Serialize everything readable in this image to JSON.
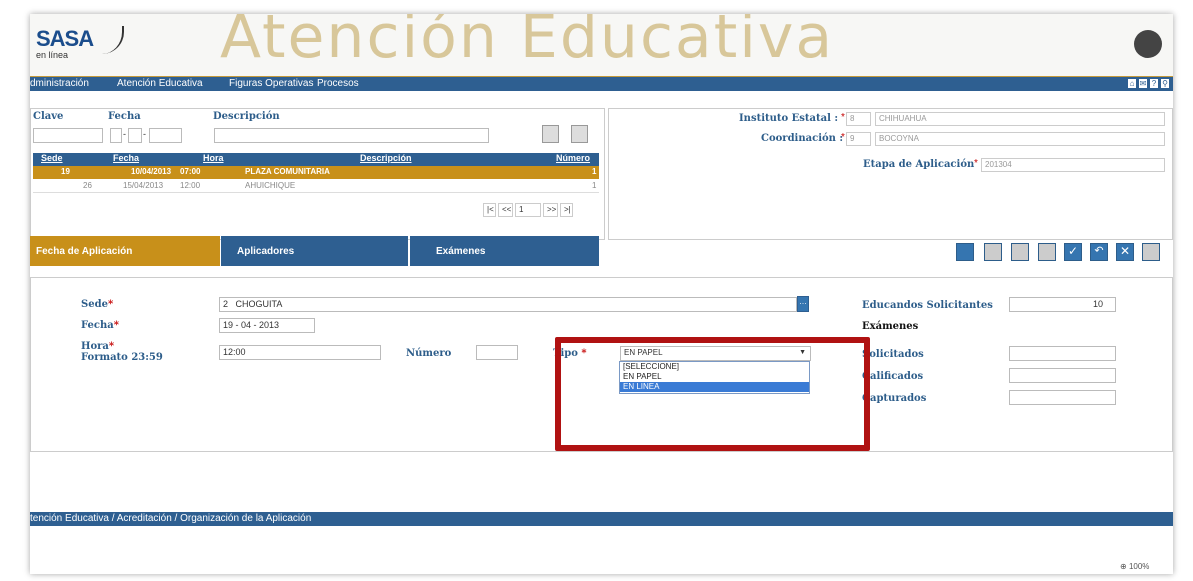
{
  "header": {
    "logo": "SASA",
    "logo_sub": "en línea",
    "banner_title": "Atención Educativa"
  },
  "nav": {
    "items": [
      "dministración",
      "Atención Educativa",
      "Figuras Operativas",
      "Procesos"
    ]
  },
  "search": {
    "clave_label": "Clave",
    "fecha_label": "Fecha",
    "descripcion_label": "Descripción"
  },
  "table": {
    "headers": [
      "Sede",
      "Fecha",
      "Hora",
      "Descripción",
      "Número"
    ],
    "rows": [
      {
        "sede": "19",
        "fecha": "10/04/2013",
        "hora": "07:00",
        "descripcion": "PLAZA COMUNITARIA",
        "numero": "1"
      },
      {
        "sede": "26",
        "fecha": "15/04/2013",
        "hora": "12:00",
        "descripcion": "AHUICHIQUE",
        "numero": "1"
      }
    ],
    "pager": {
      "first": "|<",
      "prev": "<<",
      "page": "1",
      "next": ">>",
      "last": ">|"
    }
  },
  "right_panel": {
    "instituto_label": "Instituto Estatal :",
    "instituto_code": "8",
    "instituto_value": "CHIHUAHUA",
    "coordinacion_label": "Coordinación :",
    "coordinacion_code": "9",
    "coordinacion_value": "BOCOYNA",
    "etapa_label": "Etapa de Aplicación",
    "etapa_value": "201304"
  },
  "tabs": [
    "Fecha de Aplicación",
    "Aplicadores",
    "Exámenes"
  ],
  "form": {
    "sede_label": "Sede",
    "sede_code": "2",
    "sede_name": "CHOGUITA",
    "fecha_label": "Fecha",
    "fecha_day": "19",
    "fecha_month": "04",
    "fecha_year": "2013",
    "hora_label": "Hora",
    "hora_format": "Formato 23:59",
    "hora_value": "12:00",
    "numero_label": "Número",
    "numero_value": "",
    "tipo_label": "Tipo",
    "tipo_value": "EN PAPEL",
    "tipo_options": [
      "[SELECCIONE]",
      "EN PAPEL",
      "EN LINEA"
    ],
    "educandos_label": "Educandos Solicitantes",
    "educandos_value": "10",
    "examenes_title": "Exámenes",
    "solicitados_label": "Solicitados",
    "calificados_label": "Calificados",
    "capturados_label": "Capturados"
  },
  "statusbar": {
    "breadcrumb": "tención Educativa / Acreditación / Organización de la Aplicación",
    "zoom": "100%"
  },
  "colors": {
    "nav_blue": "#2e5f91",
    "gold": "#c8901a",
    "highlight_red": "#b01212"
  }
}
